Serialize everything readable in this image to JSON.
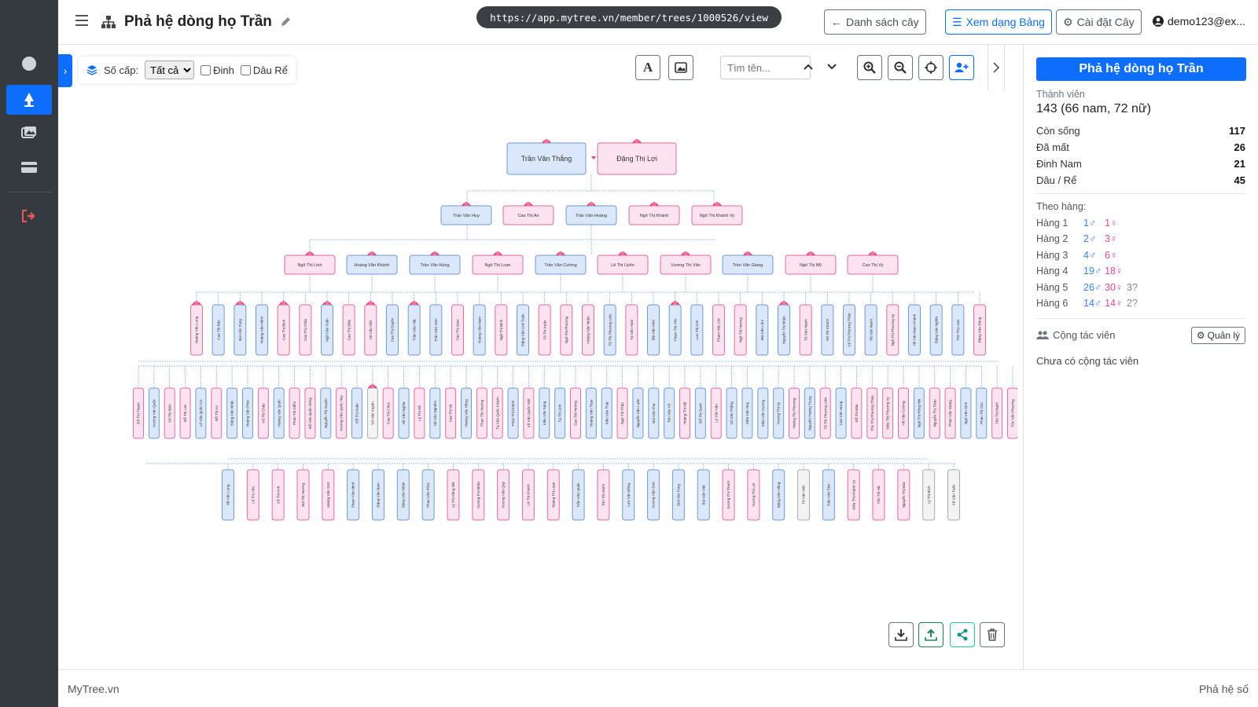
{
  "page": {
    "title": "Phả hệ dòng họ Trần"
  },
  "browser": {
    "url": "https://app.mytree.vn/member/trees/1000526/view"
  },
  "header": {
    "list_button": "Danh sách cây",
    "table_button": "Xem dạng Bảng",
    "settings_button": "Cài đặt Cây",
    "user": "demo123@ex..."
  },
  "sidebar_nav": [
    {
      "icon": "circle-icon"
    },
    {
      "icon": "tree-icon",
      "active": true
    },
    {
      "icon": "gallery-icon"
    },
    {
      "icon": "card-icon"
    },
    {
      "icon": "logout-icon"
    }
  ],
  "toolbar": {
    "generation_label": "Số cấp:",
    "generation_value": "Tất cả",
    "pin_label": "Đinh",
    "inlaw_label": "Dâu Rể",
    "search_placeholder": "Tìm tên..."
  },
  "tree": {
    "root": [
      {
        "name": "Trần Văn Thắng",
        "sex": "m"
      },
      {
        "name": "Đặng Thị Lợi",
        "sex": "f"
      }
    ],
    "gen2": [
      {
        "name": "Trần Văn Huy",
        "sex": "m"
      },
      {
        "name": "Cao Thị An",
        "sex": "f"
      },
      {
        "name": "Trần Văn Hoàng",
        "sex": "m"
      },
      {
        "name": "Ngô Thị Khánh",
        "sex": "f"
      },
      {
        "name": "Ngô Thị Khánh Vy",
        "sex": "f"
      }
    ],
    "gen3": [
      {
        "name": "Ngô Thị Linh",
        "sex": "f"
      },
      {
        "name": "Hoàng Văn Khánh",
        "sex": "m"
      },
      {
        "name": "Trần Văn Hùng",
        "sex": "m"
      },
      {
        "name": "Ngô Thị Loan",
        "sex": "f"
      },
      {
        "name": "Trần Văn Cường",
        "sex": "m"
      },
      {
        "name": "Lê Thị Uyên",
        "sex": "f"
      },
      {
        "name": "Vương Thị Vân",
        "sex": "f"
      },
      {
        "name": "Trần Văn Giang",
        "sex": "m"
      },
      {
        "name": "Ngô Thị Mỹ",
        "sex": "f"
      },
      {
        "name": "Cao Thị Vy",
        "sex": "f"
      }
    ],
    "gen4": [
      "Hoàng Văn Long",
      "Cao Thị Bảo",
      "Bùi Văn Tùng",
      "Hoàng Văn Minh",
      "Cao Thị Bích",
      "Cao Thị Châu",
      "Ngô Văn Tuấn",
      "Cao Thị Diệu",
      "Vũ Văn Việt",
      "Cao Thị Duyên",
      "Trần Văn Hải",
      "Trần Văn Vịnh",
      "Cao Thị Giao",
      "Hoàng Văn Nam",
      "Ngô Thị Định",
      "Đặng Văn Anh Tuấn",
      "Tô Thị Xuân",
      "Ngô Thị Phương",
      "Hoàng Văn Nhân",
      "Tô Thị Phương Liên",
      "Tạ Văn Hoài",
      "Bùi Văn Kiên",
      "Phạm Thị Yến",
      "Lưu Thị Anh",
      "Phạm Văn Lộc",
      "Ngô Thị Hương",
      "Bùi Văn Lâm",
      "Nguyễn Thị Nhàn",
      "Tô Văn Mạnh",
      "Hồ Thị Khánh",
      "Vũ Thị Phương Thảo",
      "Hồ Văn Mạnh",
      "Ngô Thị Phương Vy",
      "Hồ Văn Nam Khánh",
      "Đặng Văn Nghĩa",
      "Tôn Thị Loan",
      "Đặng Văn Đông"
    ],
    "gen4_sex": "fmmmffmffmmmfmfmfffmfmmmffmmfmmmfmmmfm",
    "gen5": [
      "Đỗ Thị Thanh",
      "Vương Văn Quốc",
      "Vũ Thị Bích",
      "Đỗ Thị Lan",
      "Lê Văn Quốc Cơ",
      "Đỗ Thị An",
      "Đặng Văn Nhật",
      "Hoàng Văn Phúc",
      "Vũ Thị Châu",
      "Hoàng Văn Quốc",
      "Phan Thị Diễm",
      "Đỗ Văn Quốc Dũng",
      "Nguyễn Thị Duyên",
      "Vương Văn Quốc Huy",
      "Đỗ Thị Xuân",
      "Vũ Văn Xuyên",
      "Cao Thị Chúc",
      "Hồ Văn Nghĩa",
      "Lý Thị Hà",
      "Hồ Văn Nghiêm",
      "Cao Thị Vịt",
      "Hoàng Văn Hồng",
      "Phan Thị Hương",
      "Tạ Văn Quốc Khánh",
      "Phan Thị Khánh",
      "Vũ Văn Quốc Việt",
      "Kiều Văn Sang",
      "Tạ Thị Linh",
      "Cao Thị Hường",
      "Hoàng Văn Thạo",
      "Kiều Văn Thái",
      "Ngô Thị Thảo",
      "Nguyễn Văn Luân",
      "Bùi Văn Thư",
      "Tôn Văn Vũ",
      "Hoàng Thị Mỹ",
      "Đỗ Thị Oanh",
      "Lý Văn Vân",
      "Vũ Văn Thắng",
      "Kiều Văn Huy",
      "Kiều Văn Vương",
      "Vương Thị Vy",
      "Hoàng Thị Phương",
      "Nguyễn Hoàng Trung",
      "Tô Thị Phương Liên",
      "Cao Văn Hưng",
      "Đỗ Thị Bảo",
      "Tôn Thị Phương Thảo",
      "Kiều Thị Phương Vy",
      "Hồ Văn Cường",
      "Ngô Thị Hồng Nhi",
      "Nguyễn Thị Thảo",
      "Phan Văn Giang",
      "Ngô Văn Vịnh",
      "Phan Thị Cúc",
      "Tôn Thị Hạnh",
      "Tôn Văn Phương"
    ],
    "gen5_sex": "fmffmfmmfmffmfmufmfmfmffmfmmfmmfmmmfmfmmmmfmfmffffmffmmfff",
    "gen6": [
      "Hồ Văn Long",
      "Lê Thị Yến",
      "Vũ Thị Anh",
      "Bùi Thị Hương",
      "Hoàng Văn Sơn",
      "Phạm Văn Minh",
      "Đặng Văn Nam",
      "Đặng Văn Nhân",
      "Phan Văn Phúc",
      "Lý Thị Hồng Nhi",
      "Vương Thị Nhàn",
      "Vương Văn Quý",
      "Lê Thị Khánh",
      "Hoàng Thị Loan",
      "Trần Văn Quân",
      "Tôn Thị Oanh",
      "Lưu Văn Đồng",
      "Vương Văn Sơn",
      "Bùi Văn Tùng",
      "Bùi Văn Việt",
      "Vương Thị Thanh",
      "Vương Thị Lợi",
      "Đặng Văn Hồng",
      "Tô Văn Việt",
      "Trần Văn Tâm",
      "Kiều Thị Khánh Vy",
      "Tôn Thị Hà",
      "Nguyễn Thị Bảo",
      "Lý Thị Bích",
      "Vũ Văn Tuấn"
    ],
    "gen6_sex": "mffffmmmmfffffmfmmmmffmumfffuu"
  },
  "stats": {
    "title": "Phả hệ dòng họ Trần",
    "members_label": "Thành viên",
    "members_total": "143 (66 nam, 72 nữ)",
    "rows": [
      {
        "label": "Còn sống",
        "value": "117"
      },
      {
        "label": "Đã mất",
        "value": "26"
      },
      {
        "label": "Đinh Nam",
        "value": "21"
      },
      {
        "label": "Dâu / Rể",
        "value": "45"
      }
    ],
    "by_gen_label": "Theo hàng:",
    "generations": [
      {
        "label": "Hàng 1",
        "male": "1♂",
        "female": "1♀",
        "unknown": ""
      },
      {
        "label": "Hàng 2",
        "male": "2♂",
        "female": "3♀",
        "unknown": ""
      },
      {
        "label": "Hàng 3",
        "male": "4♂",
        "female": "6♀",
        "unknown": ""
      },
      {
        "label": "Hàng 4",
        "male": "19♂",
        "female": "18♀",
        "unknown": ""
      },
      {
        "label": "Hàng 5",
        "male": "26♂",
        "female": "30♀",
        "unknown": "3?"
      },
      {
        "label": "Hàng 6",
        "male": "14♂",
        "female": "14♀",
        "unknown": "2?"
      }
    ],
    "collab_label": "Cộng tác viên",
    "manage_button": "Quản lý",
    "no_collab": "Chưa có cộng tác viên"
  },
  "footer": {
    "left": "MyTree.vn",
    "right": "Phả hệ số"
  },
  "colors": {
    "male_fill": "#dbe8fb",
    "male_border": "#6f9ad8",
    "female_fill": "#fde3ef",
    "female_border": "#e56aa3",
    "unknown_fill": "#f3f3f3",
    "unknown_border": "#aaaaaa",
    "accent": "#0d6efd"
  }
}
